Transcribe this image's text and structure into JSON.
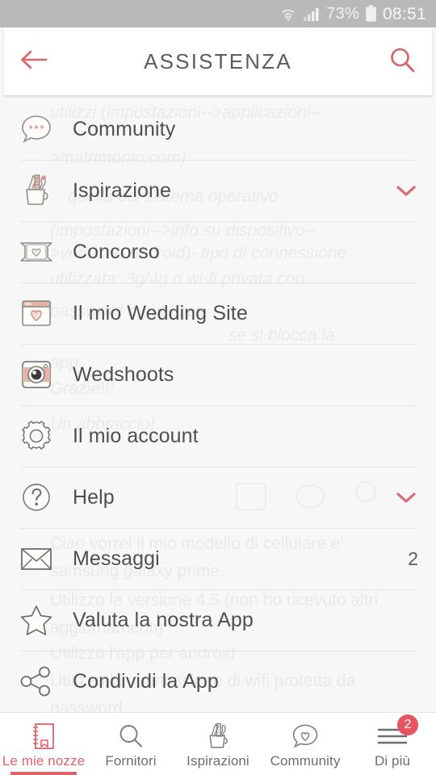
{
  "statusbar": {
    "wifi_icon": "wifi-icon",
    "signal_icon": "signal-icon",
    "battery_percent": "73%",
    "battery_icon": "battery-icon",
    "clock": "08:51"
  },
  "header": {
    "back_icon": "back-arrow-icon",
    "title": "ASSISTENZA",
    "search_icon": "search-icon"
  },
  "colors": {
    "accent": "#e0636b",
    "badge": "#e5555f",
    "text": "#4f4f4f",
    "statusbar_bg": "#b9b9b9",
    "page_bg": "#f7f7f7"
  },
  "menu": {
    "items": [
      {
        "icon": "chat-bubble-icon",
        "label": "Community",
        "chevron": false,
        "count": ""
      },
      {
        "icon": "pencil-cup-icon",
        "label": "Ispirazione",
        "chevron": true,
        "count": ""
      },
      {
        "icon": "ticket-heart-icon",
        "label": "Concorso",
        "chevron": false,
        "count": ""
      },
      {
        "icon": "browser-heart-icon",
        "label": "Il mio Wedding Site",
        "chevron": false,
        "count": ""
      },
      {
        "icon": "camera-icon",
        "label": "Wedshoots",
        "chevron": false,
        "count": ""
      },
      {
        "icon": "gear-icon",
        "label": "Il mio account",
        "chevron": false,
        "count": ""
      },
      {
        "icon": "question-circle-icon",
        "label": "Help",
        "chevron": true,
        "count": ""
      },
      {
        "icon": "envelope-icon",
        "label": "Messaggi",
        "chevron": false,
        "count": "2"
      },
      {
        "icon": "star-icon",
        "label": "Valuta la nostra App",
        "chevron": false,
        "count": ""
      },
      {
        "icon": "share-icon",
        "label": "Condividi la App",
        "chevron": false,
        "count": ""
      }
    ]
  },
  "ghost_text": {
    "lines": [
      "utilizzi (impostazioni-->applicazioni--",
      ">matrimonio.com)",
      "quella del sistema operativo",
      "(impostazioni-->info su dispositivo--",
      ">versione android)- tipo di connessione",
      "utilizzata: 3g/4g o wi-fi privata con",
      "password o pubblica",
      "- se si blocca la",
      "app",
      "Grazie!!!",
      "Un abbraccio!",
      "Ciao vorrei il mio modello di cellulare e'",
      "samsung galaxy prime.",
      "Utilizzo la versione 4.5 (non ho ricevuto altri",
      "aggiornamenti)",
      "Utilizzo l'app per android",
      "Utilizzo la connessione di wifi protetta da",
      "password"
    ]
  },
  "bottomnav": {
    "items": [
      {
        "icon": "notebook-icon",
        "label": "Le mie nozze",
        "active": true,
        "badge": ""
      },
      {
        "icon": "search-icon",
        "label": "Fornitori",
        "active": false,
        "badge": ""
      },
      {
        "icon": "pencil-cup-icon",
        "label": "Ispirazioni",
        "active": false,
        "badge": ""
      },
      {
        "icon": "heart-bubble-icon",
        "label": "Community",
        "active": false,
        "badge": ""
      },
      {
        "icon": "hamburger-icon",
        "label": "Di più",
        "active": false,
        "badge": "2"
      }
    ]
  }
}
